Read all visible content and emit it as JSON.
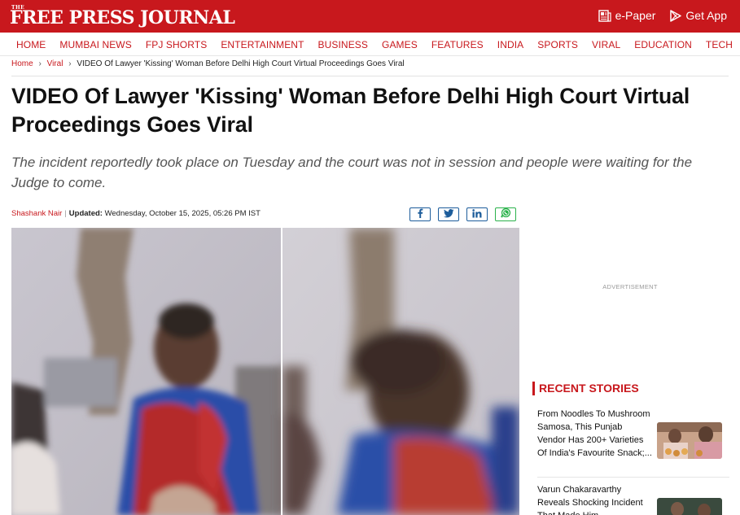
{
  "brand": {
    "logo_the": "THE",
    "logo_name": "FREE PRESS JOURNAL",
    "epaper_label": "e-Paper",
    "getapp_label": "Get App"
  },
  "nav": {
    "items": [
      "HOME",
      "MUMBAI NEWS",
      "FPJ SHORTS",
      "ENTERTAINMENT",
      "BUSINESS",
      "GAMES",
      "FEATURES",
      "INDIA",
      "SPORTS",
      "VIRAL",
      "EDUCATION",
      "TECH"
    ]
  },
  "breadcrumb": {
    "home": "Home",
    "section": "Viral",
    "separator": "›",
    "current": "VIDEO Of Lawyer 'Kissing' Woman Before Delhi High Court Virtual Proceedings Goes Viral"
  },
  "article": {
    "headline": "VIDEO Of Lawyer 'Kissing' Woman Before Delhi High Court Virtual Proceedings Goes Viral",
    "summary": "The incident reportedly took place on Tuesday and the court was not in session and people were waiting for the Judge to come.",
    "author": "Shashank Nair",
    "updated_label": "Updated:",
    "updated_value": "Wednesday, October 15, 2025, 05:26 PM IST"
  },
  "share": {
    "icons": [
      "facebook-icon",
      "twitter-icon",
      "linkedin-icon",
      "whatsapp-icon"
    ]
  },
  "sidebar": {
    "ad_label": "ADVERTISEMENT",
    "recent_title": "RECENT STORIES",
    "stories": [
      {
        "title": "From Noodles To Mushroom Samosa, This Punjab Vendor Has 200+ Varieties Of India's Favourite Snack;..."
      },
      {
        "title": "Varun Chakaravarthy Reveals Shocking Incident That Made Him..."
      }
    ]
  },
  "colors": {
    "brand_red": "#c8181d",
    "summary_grey": "#555555",
    "social_blue": "#1d5d9b",
    "whatsapp_green": "#2bb24c"
  }
}
